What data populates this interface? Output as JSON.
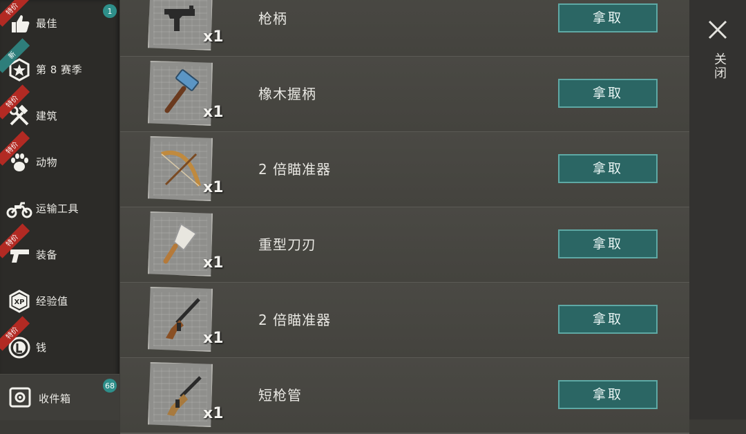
{
  "sidebar": {
    "items": [
      {
        "label": "最佳",
        "icon": "thumbs-up-icon",
        "ribbon": "特价",
        "badge": "1"
      },
      {
        "label": "第 8 赛季",
        "icon": "season-star-icon",
        "ribbon": "新"
      },
      {
        "label": "建筑",
        "icon": "hammer-wrench-icon",
        "ribbon": "特价"
      },
      {
        "label": "动物",
        "icon": "paw-icon",
        "ribbon": "特价"
      },
      {
        "label": "运输工具",
        "icon": "motorcycle-icon"
      },
      {
        "label": "装备",
        "icon": "pistol-icon",
        "ribbon": "特价"
      },
      {
        "label": "经验值",
        "icon": "xp-icon"
      },
      {
        "label": "钱",
        "icon": "coin-icon",
        "ribbon": "特价"
      }
    ],
    "inbox": {
      "label": "收件箱",
      "icon": "safe-icon",
      "badge": "68"
    }
  },
  "list": {
    "rows": [
      {
        "name": "枪柄",
        "qty": "x1",
        "icon": "uzi-icon",
        "button": "拿取"
      },
      {
        "name": "橡木握柄",
        "qty": "x1",
        "icon": "hammer-icon",
        "button": "拿取"
      },
      {
        "name": "2 倍瞄准器",
        "qty": "x1",
        "icon": "bow-icon",
        "button": "拿取"
      },
      {
        "name": "重型刀刃",
        "qty": "x1",
        "icon": "cleaver-icon",
        "button": "拿取"
      },
      {
        "name": "2 倍瞄准器",
        "qty": "x1",
        "icon": "rifle-icon",
        "button": "拿取"
      },
      {
        "name": "短枪管",
        "qty": "x1",
        "icon": "assault-rifle-icon",
        "button": "拿取"
      }
    ]
  },
  "close_panel": {
    "label": "关闭",
    "icon": "close-icon"
  },
  "colors": {
    "accent": "#2b6664",
    "ribbon_red": "#b22a23",
    "ribbon_teal": "#2e7e7b",
    "badge": "#2e8f8a"
  }
}
